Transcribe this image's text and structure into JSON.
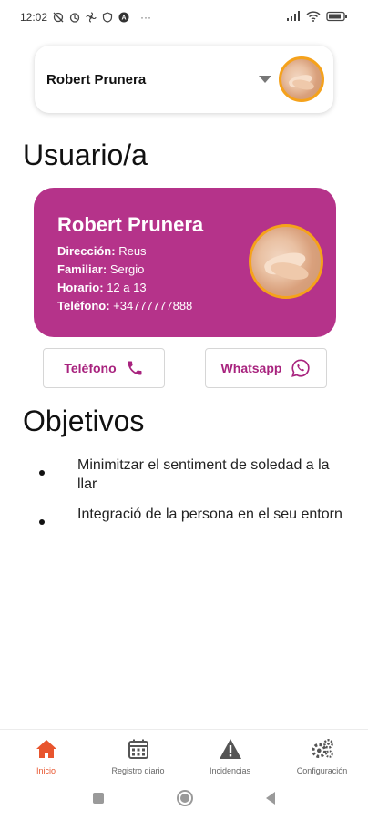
{
  "status_bar": {
    "time": "12:02",
    "more": "···"
  },
  "selector": {
    "selected_user": "Robert Prunera"
  },
  "sections": {
    "usuario": "Usuario/a",
    "objetivos": "Objetivos"
  },
  "user_card": {
    "name": "Robert Prunera",
    "direccion_label": "Dirección:",
    "direccion_value": "Reus",
    "familiar_label": "Familiar:",
    "familiar_value": "Sergio",
    "horario_label": "Horario:",
    "horario_value": "12 a 13",
    "telefono_label": "Teléfono:",
    "telefono_value": "+34777777888",
    "color": "#b5338a"
  },
  "actions": {
    "phone_label": "Teléfono",
    "whatsapp_label": "Whatsapp"
  },
  "objectives": [
    "Minimitzar el sentiment de soledad a la llar",
    "Integració de la persona en el seu entorn"
  ],
  "bottom_nav": {
    "items": [
      {
        "label": "Inicio",
        "icon": "home-icon",
        "active": true
      },
      {
        "label": "Registro diario",
        "icon": "calendar-icon",
        "active": false
      },
      {
        "label": "Incidencias",
        "icon": "warning-icon",
        "active": false
      },
      {
        "label": "Configuración",
        "icon": "gears-icon",
        "active": false
      }
    ],
    "active_color": "#e8552e"
  }
}
